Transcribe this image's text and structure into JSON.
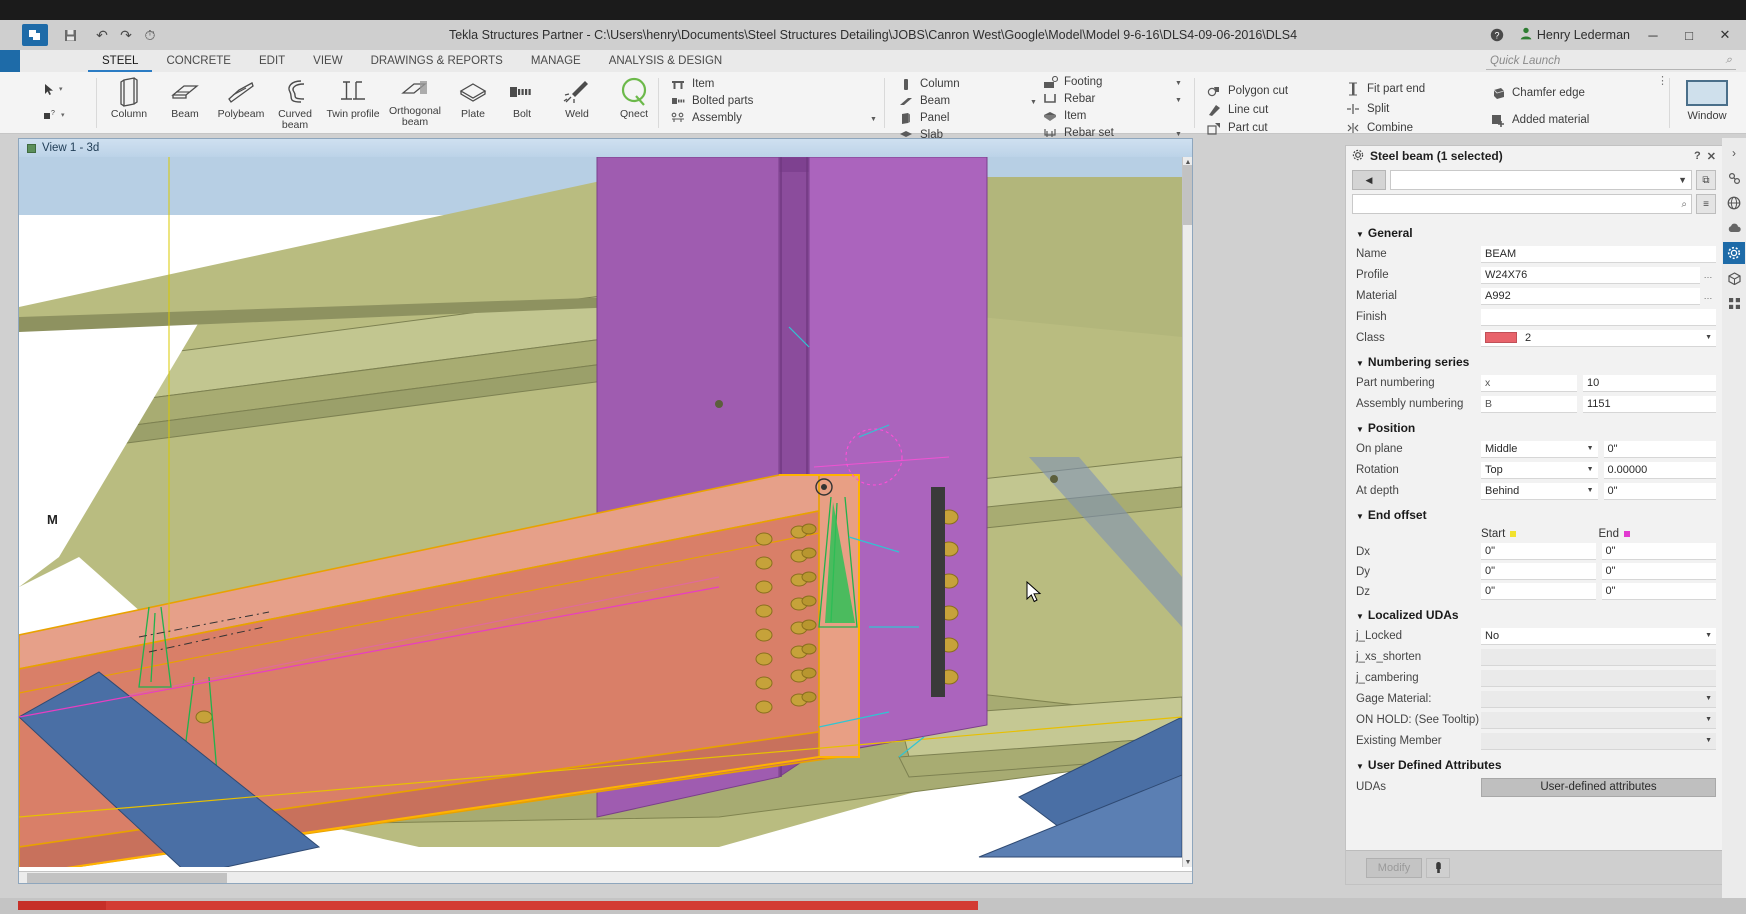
{
  "window": {
    "title": "Tekla Structures Partner - C:\\Users\\henry\\Documents\\Steel Structures Detailing\\JOBS\\Canron West\\Google\\Model\\Model 9-6-16\\DLS4-09-06-2016\\DLS4",
    "user": "Henry Lederman",
    "logo_text": "T",
    "help_icon": "help-icon",
    "user_icon": "user-icon",
    "minimize": "─",
    "maximize": "□",
    "close": "✕"
  },
  "quick_access": {
    "save": "ὋE",
    "undo": "↶",
    "redo": "↷",
    "history": "⏱"
  },
  "quick_launch": {
    "placeholder": "Quick Launch",
    "value": "",
    "icon": "search-icon"
  },
  "tabs": [
    {
      "label": "STEEL",
      "active": true
    },
    {
      "label": "CONCRETE",
      "active": false
    },
    {
      "label": "EDIT",
      "active": false
    },
    {
      "label": "VIEW",
      "active": false
    },
    {
      "label": "DRAWINGS & REPORTS",
      "active": false
    },
    {
      "label": "MANAGE",
      "active": false
    },
    {
      "label": "ANALYSIS & DESIGN",
      "active": false
    }
  ],
  "ribbon": {
    "cursor_tools": [
      {
        "icon": "select-arrow-icon",
        "caret": "▾"
      },
      {
        "icon": "select-object-icon",
        "caret": "▾"
      }
    ],
    "big_buttons": [
      {
        "label": "Column",
        "icon": "column-icon"
      },
      {
        "label": "Beam",
        "icon": "beam-icon"
      },
      {
        "label": "Polybeam",
        "icon": "polybeam-icon"
      },
      {
        "label": "Curved beam",
        "icon": "curved-beam-icon"
      },
      {
        "label": "Twin profile",
        "icon": "twin-profile-icon"
      },
      {
        "label": "Orthogonal beam",
        "icon": "orthogonal-beam-icon"
      },
      {
        "label": "Plate",
        "icon": "plate-icon"
      },
      {
        "label": "Bolt",
        "icon": "bolt-icon"
      },
      {
        "label": "Weld",
        "icon": "weld-icon"
      },
      {
        "label": "Qnect",
        "icon": "qnect-icon"
      }
    ],
    "connect_group": [
      {
        "label": "Item",
        "icon": "item-icon",
        "caret": false
      },
      {
        "label": "Bolted parts",
        "icon": "bolted-parts-icon",
        "caret": false
      },
      {
        "label": "Assembly",
        "icon": "assembly-icon",
        "caret": true
      }
    ],
    "concrete_group": [
      {
        "label": "Column",
        "icon": "concrete-column-icon",
        "caret": false
      },
      {
        "label": "Beam",
        "icon": "concrete-beam-icon",
        "caret": true
      },
      {
        "label": "Panel",
        "icon": "panel-icon",
        "caret": false
      },
      {
        "label": "Slab",
        "icon": "slab-icon",
        "caret": false
      }
    ],
    "rebar_group": [
      {
        "label": "Footing",
        "icon": "footing-icon",
        "caret": true
      },
      {
        "label": "Rebar",
        "icon": "rebar-icon",
        "caret": true
      },
      {
        "label": "Item",
        "icon": "rebar-item-icon",
        "caret": false
      },
      {
        "label": "Rebar set",
        "icon": "rebar-set-icon",
        "caret": true
      }
    ],
    "cut_group": [
      {
        "label": "Polygon cut",
        "icon": "polygon-cut-icon"
      },
      {
        "label": "Line cut",
        "icon": "line-cut-icon"
      },
      {
        "label": "Part cut",
        "icon": "part-cut-icon"
      }
    ],
    "fit_group": [
      {
        "label": "Fit part end",
        "icon": "fit-part-end-icon"
      },
      {
        "label": "Split",
        "icon": "split-icon"
      },
      {
        "label": "Combine",
        "icon": "combine-icon"
      }
    ],
    "edge_group": [
      {
        "label": "Chamfer edge",
        "icon": "chamfer-edge-icon"
      },
      {
        "label": "Added material",
        "icon": "added-material-icon"
      }
    ],
    "window_button": {
      "label": "Window",
      "icon": "window-icon"
    },
    "overflow": "⋮"
  },
  "view": {
    "tab_label": "View 1 - 3d",
    "tab_icon": "view-3d-icon",
    "marker_label": "M"
  },
  "properties": {
    "header": "Steel beam (1 selected)",
    "header_icon": "gear-icon",
    "help_icon": "?",
    "close_icon": "✕",
    "back_icon": "◀",
    "list_icon": "≡",
    "save_icon": "⧉",
    "search_icon": "⌕",
    "preset_value": "",
    "search_value": "",
    "sections": {
      "general": {
        "title": "General",
        "rows": [
          {
            "label": "Name",
            "value": "BEAM",
            "type": "text"
          },
          {
            "label": "Profile",
            "value": "W24X76",
            "type": "text-btn"
          },
          {
            "label": "Material",
            "value": "A992",
            "type": "text-btn"
          },
          {
            "label": "Finish",
            "value": "",
            "type": "text"
          },
          {
            "label": "Class",
            "value": "2",
            "type": "color",
            "color": "#e8636b"
          }
        ]
      },
      "numbering": {
        "title": "Numbering series",
        "rows": [
          {
            "label": "Part numbering",
            "key": "x",
            "value": "10"
          },
          {
            "label": "Assembly numbering",
            "key": "B",
            "value": "1151"
          }
        ]
      },
      "position": {
        "title": "Position",
        "rows": [
          {
            "label": "On plane",
            "select": "Middle",
            "value": "0\""
          },
          {
            "label": "Rotation",
            "select": "Top",
            "value": "0.00000"
          },
          {
            "label": "At depth",
            "select": "Behind",
            "value": "0\""
          }
        ]
      },
      "end_offset": {
        "title": "End offset",
        "col_start": "Start",
        "col_end": "End",
        "rows": [
          {
            "label": "Dx",
            "start": "0\"",
            "end": "0\""
          },
          {
            "label": "Dy",
            "start": "0\"",
            "end": "0\""
          },
          {
            "label": "Dz",
            "start": "0\"",
            "end": "0\""
          }
        ]
      },
      "localized_udas": {
        "title": "Localized UDAs",
        "rows": [
          {
            "label": "j_Locked",
            "value": "No",
            "type": "dropdown"
          },
          {
            "label": "j_xs_shorten",
            "value": "",
            "type": "text-gray"
          },
          {
            "label": "j_cambering",
            "value": "",
            "type": "text-gray"
          },
          {
            "label": "Gage Material:",
            "value": "",
            "type": "dropdown-gray"
          },
          {
            "label": "ON HOLD: (See Tooltip)",
            "value": "",
            "type": "dropdown-gray"
          },
          {
            "label": "Existing Member",
            "value": "",
            "type": "dropdown-gray"
          }
        ]
      },
      "user_defined": {
        "title": "User Defined Attributes",
        "rows": [
          {
            "label": "UDAs",
            "button": "User-defined attributes"
          }
        ]
      }
    },
    "footer": {
      "modify": "Modify",
      "pick_icon": "eyedropper-icon"
    }
  },
  "right_rail": [
    {
      "icon": "chevron-right-icon",
      "active": false
    },
    {
      "icon": "settings-link-icon",
      "active": false
    },
    {
      "icon": "globe-icon",
      "active": false
    },
    {
      "icon": "cloud-icon",
      "active": false
    },
    {
      "icon": "gear-icon",
      "active": true
    },
    {
      "icon": "cube-icon",
      "active": false
    },
    {
      "icon": "apps-icon",
      "active": false
    }
  ],
  "colors": {
    "accent": "#1e6ba8",
    "tab_underline": "#2b7cc4",
    "class_swatch": "#e8636b",
    "status_red": "#d33b33",
    "selected_beam": "#e08a73",
    "column_purple": "#a05ab0",
    "beam_olive": "#b3b678",
    "brace_blue": "#4a6fa5"
  }
}
